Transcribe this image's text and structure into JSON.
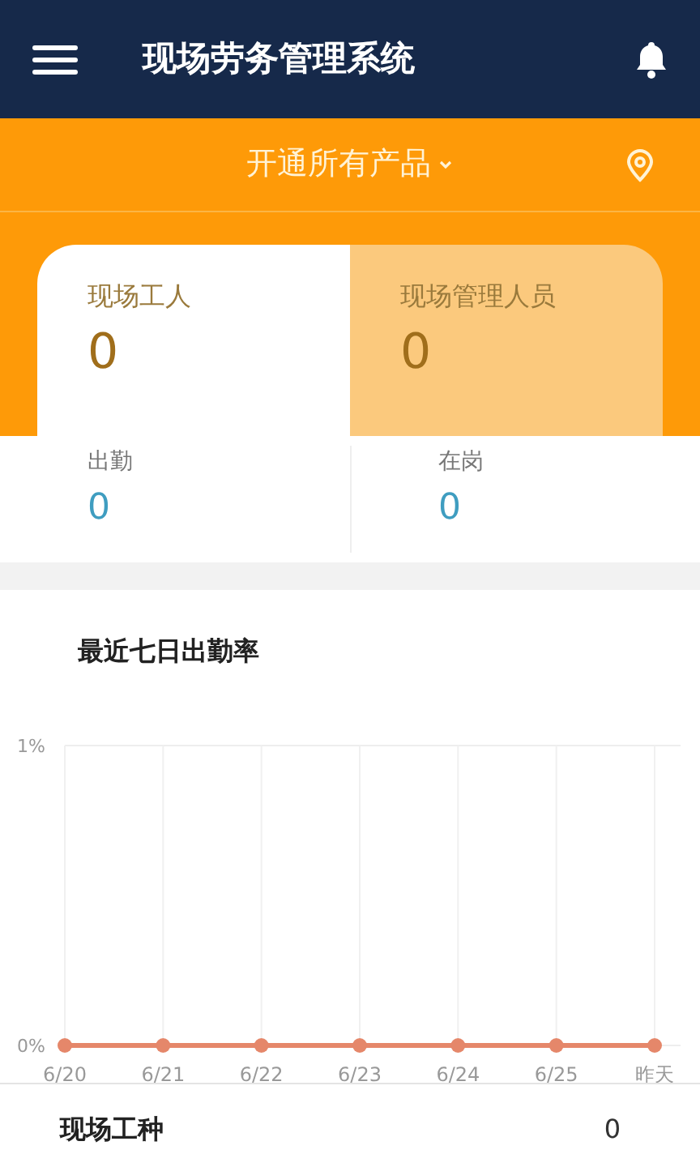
{
  "header": {
    "title": "现场劳务管理系统"
  },
  "product_selector": {
    "label": "开通所有产品"
  },
  "summary_tabs": [
    {
      "label": "现场工人",
      "value": "0",
      "selected": true
    },
    {
      "label": "现场管理人员",
      "value": "0",
      "selected": false
    }
  ],
  "stats": [
    {
      "label": "出勤",
      "value": "0"
    },
    {
      "label": "在岗",
      "value": "0"
    }
  ],
  "attendance": {
    "title": "最近七日出勤率",
    "chart_data": {
      "type": "line",
      "categories": [
        "6/20",
        "6/21",
        "6/22",
        "6/23",
        "6/24",
        "6/25",
        "昨天"
      ],
      "grid": true,
      "series": [
        {
          "color": "#e5876a",
          "marker": true,
          "values": [
            0,
            0,
            0,
            0,
            0,
            0,
            0
          ]
        }
      ],
      "ylim": [
        0,
        1
      ],
      "yticks": [
        {
          "value": 0,
          "label": "0%"
        },
        {
          "value": 1,
          "label": "1%"
        }
      ]
    }
  },
  "work_types": {
    "label": "现场工种",
    "value": "0"
  }
}
